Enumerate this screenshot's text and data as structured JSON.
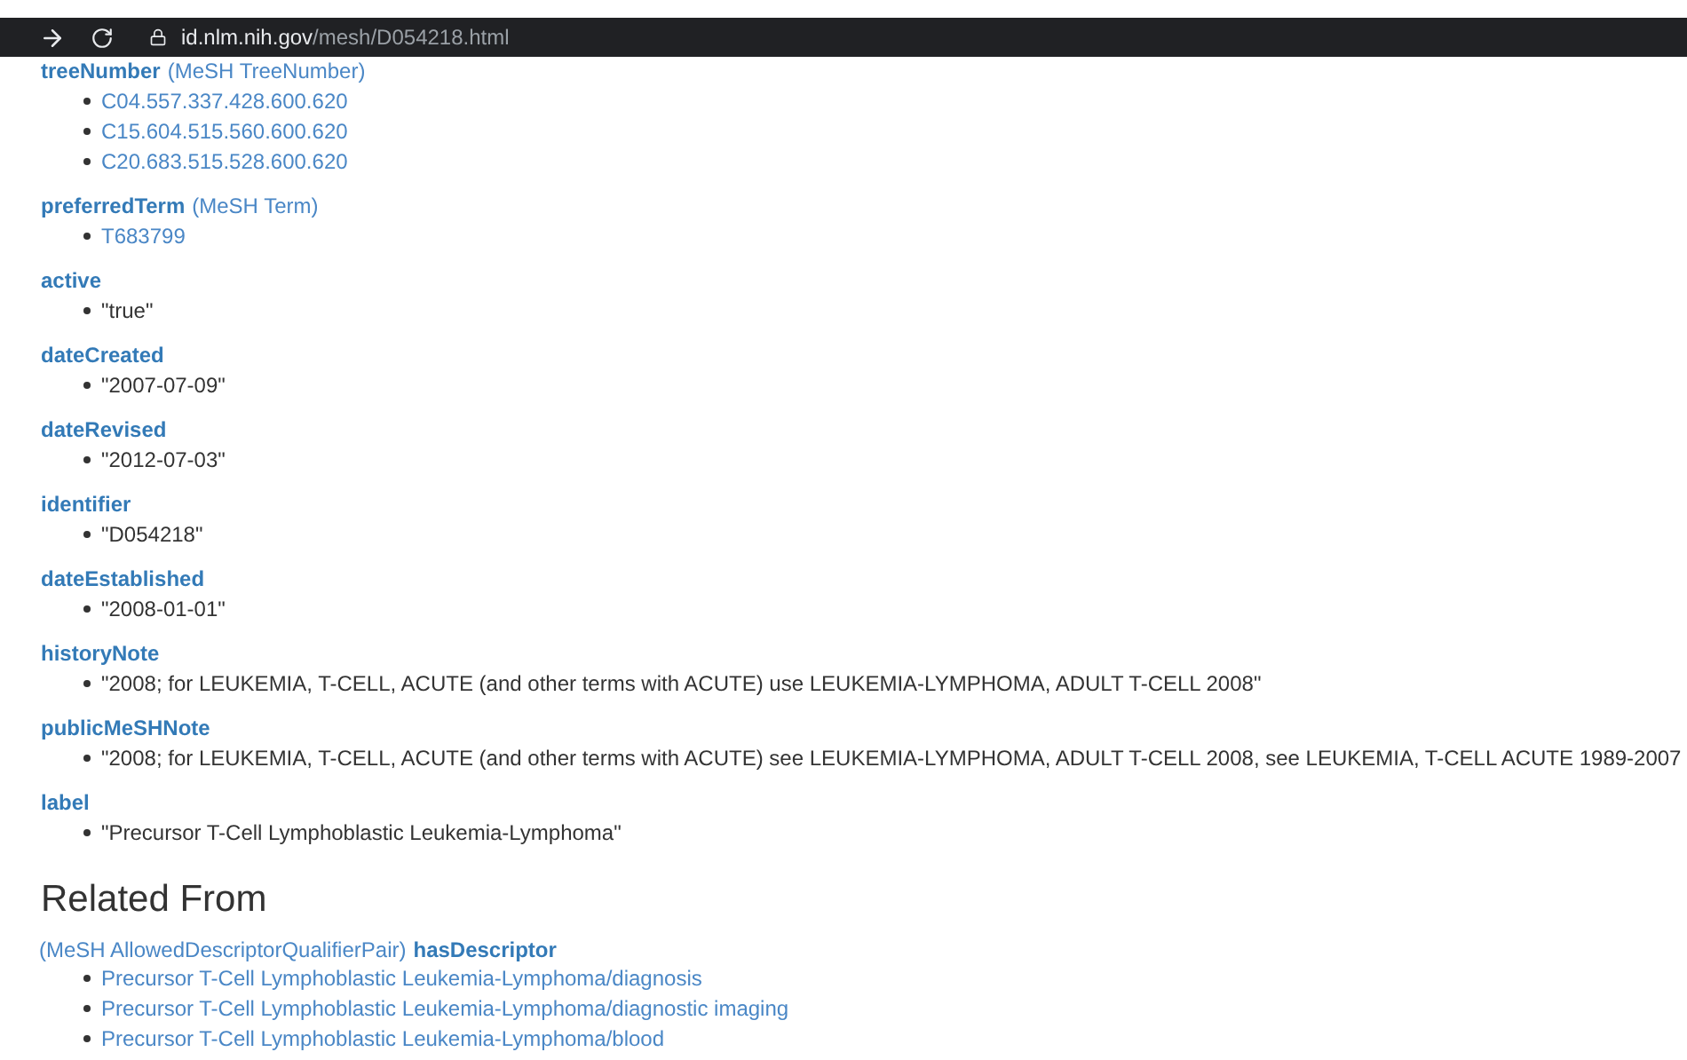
{
  "address_bar": {
    "host": "id.nlm.nih.gov",
    "path": "/mesh/D054218.html"
  },
  "properties": [
    {
      "name": "treeNumber",
      "type_label": "(MeSH TreeNumber)",
      "values": [
        {
          "kind": "link",
          "text": "C04.557.337.428.600.620"
        },
        {
          "kind": "link",
          "text": "C15.604.515.560.600.620"
        },
        {
          "kind": "link",
          "text": "C20.683.515.528.600.620"
        }
      ]
    },
    {
      "name": "preferredTerm",
      "type_label": "(MeSH Term)",
      "values": [
        {
          "kind": "link",
          "text": "T683799"
        }
      ]
    },
    {
      "name": "active",
      "values": [
        {
          "kind": "literal",
          "text": "\"true\""
        }
      ]
    },
    {
      "name": "dateCreated",
      "values": [
        {
          "kind": "literal",
          "text": "\"2007-07-09\""
        }
      ]
    },
    {
      "name": "dateRevised",
      "values": [
        {
          "kind": "literal",
          "text": "\"2012-07-03\""
        }
      ]
    },
    {
      "name": "identifier",
      "values": [
        {
          "kind": "literal",
          "text": "\"D054218\""
        }
      ]
    },
    {
      "name": "dateEstablished",
      "values": [
        {
          "kind": "literal",
          "text": "\"2008-01-01\""
        }
      ]
    },
    {
      "name": "historyNote",
      "values": [
        {
          "kind": "literal",
          "text": "\"2008; for LEUKEMIA, T-CELL, ACUTE (and other terms with ACUTE) use LEUKEMIA-LYMPHOMA, ADULT T-CELL 2008\""
        }
      ]
    },
    {
      "name": "publicMeSHNote",
      "values": [
        {
          "kind": "literal",
          "text": "\"2008; for LEUKEMIA, T-CELL, ACUTE (and other terms with ACUTE) see LEUKEMIA-LYMPHOMA, ADULT T-CELL 2008, see LEUKEMIA, T-CELL ACUTE 1989-2007"
        }
      ]
    },
    {
      "name": "label",
      "values": [
        {
          "kind": "literal",
          "text": "\"Precursor T-Cell Lymphoblastic Leukemia-Lymphoma\""
        }
      ]
    }
  ],
  "related": {
    "heading": "Related From",
    "groups": [
      {
        "type_label": "(MeSH AllowedDescriptorQualifierPair)",
        "name": "hasDescriptor",
        "values": [
          {
            "kind": "link",
            "text": "Precursor T-Cell Lymphoblastic Leukemia-Lymphoma/diagnosis"
          },
          {
            "kind": "link",
            "text": "Precursor T-Cell Lymphoblastic Leukemia-Lymphoma/diagnostic imaging"
          },
          {
            "kind": "link",
            "text": "Precursor T-Cell Lymphoblastic Leukemia-Lymphoma/blood"
          }
        ]
      }
    ]
  }
}
